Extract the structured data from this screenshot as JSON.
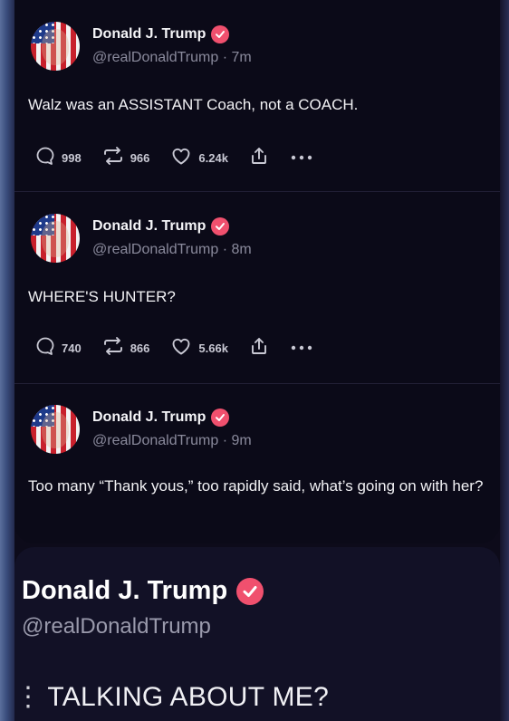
{
  "posts": [
    {
      "author": "Donald J. Trump",
      "handle": "@realDonaldTrump · 7m",
      "text": "Walz was an ASSISTANT Coach, not a COACH.",
      "replies": "998",
      "reposts": "966",
      "likes": "6.24k"
    },
    {
      "author": "Donald J. Trump",
      "handle": "@realDonaldTrump · 8m",
      "text": "WHERE'S HUNTER?",
      "replies": "740",
      "reposts": "866",
      "likes": "5.66k"
    },
    {
      "author": "Donald J. Trump",
      "handle": "@realDonaldTrump · 9m",
      "text": "Too many “Thank yous,” too rapidly said, what’s going on with her?"
    }
  ],
  "featured": {
    "author": "Donald J. Trump",
    "handle": "@realDonaldTrump",
    "text_prefix": "⋮",
    "text": "TALKING ABOUT ME?"
  },
  "colors": {
    "background": "#0b0a18",
    "verified": "#f0506e",
    "muted": "#8a8a9c"
  },
  "icons": [
    "reply-icon",
    "repost-icon",
    "like-icon",
    "share-icon",
    "more-icon",
    "verified-icon"
  ]
}
